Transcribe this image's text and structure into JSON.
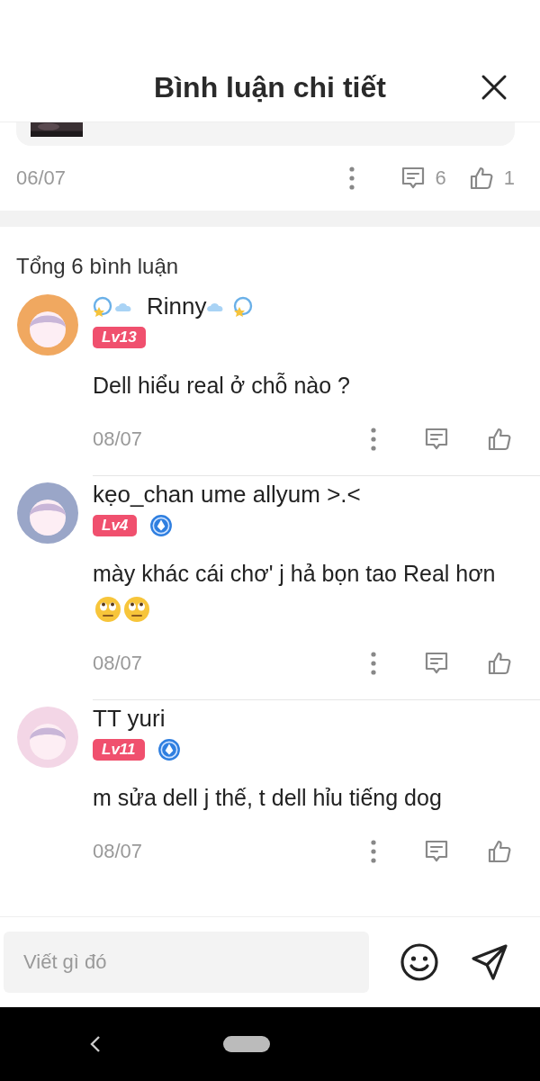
{
  "header": {
    "title": "Bình luận chi tiết"
  },
  "post": {
    "date": "06/07",
    "comment_count": "6",
    "like_count": "1"
  },
  "comments_total": "Tổng 6 bình luận",
  "comments": [
    {
      "name": "Rinny",
      "decorated": true,
      "level": "Lv13",
      "verified": false,
      "text": "Dell hiểu real ở chỗ nào ?",
      "date": "08/07"
    },
    {
      "name": "kẹo_chan ume allyum >.<",
      "decorated": false,
      "level": "Lv4",
      "verified": true,
      "text": "mày khác cái chơ' j hả bọn tao Real hơn",
      "emojis": [
        {
          "kind": "eye-roll"
        },
        {
          "kind": "eye-roll"
        }
      ],
      "date": "08/07"
    },
    {
      "name": "TT yuri",
      "decorated": false,
      "level": "Lv11",
      "verified": true,
      "text": "m sửa dell j thế, t dell hỉu tiếng dog",
      "date": "08/07"
    }
  ],
  "composer": {
    "placeholder": "Viết gì đó"
  }
}
